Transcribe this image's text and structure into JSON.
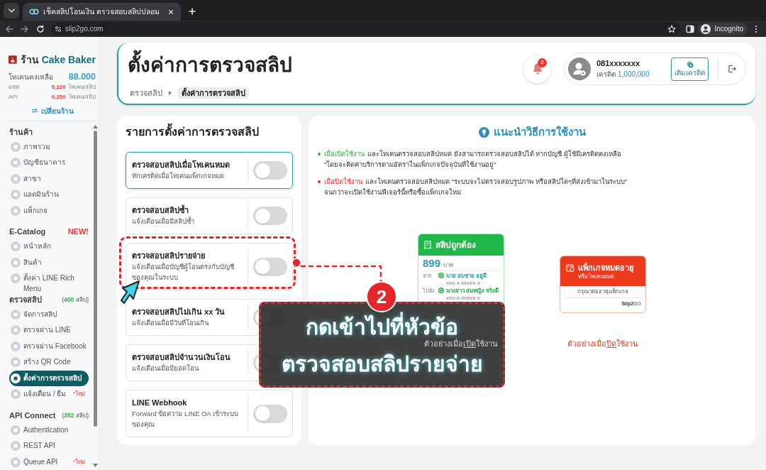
{
  "browser": {
    "tab_title": "เช็คสลิปโอนเงิน ตรวจสอบสลิปปลอม",
    "url": "slip2go.com",
    "profile": "Incognito"
  },
  "sidebar": {
    "shop": {
      "prefix": "ร้าน",
      "name": "Cake Baker"
    },
    "balance": {
      "label": "โทเคนคงเหลือ",
      "value": "88.000"
    },
    "rates": [
      {
        "label": "แชท",
        "value": "0.220",
        "unit": "โทเคน/สลิป"
      },
      {
        "label": "API",
        "value": "0.250",
        "unit": "โทเคน/สลิป"
      }
    ],
    "switch_shop": "เปลี่ยนร้าน",
    "sections": [
      {
        "title": "ร้านค้า",
        "items": [
          {
            "label": "ภาพรวม",
            "selected": false
          },
          {
            "label": "บัญชีธนาคาร",
            "selected": false
          },
          {
            "label": "สาขา",
            "selected": false
          },
          {
            "label": "แอดมินร้าน",
            "selected": false
          },
          {
            "label": "แพ็กเกจ",
            "selected": false
          }
        ]
      },
      {
        "title": "E-Catalog",
        "tag": "NEW!",
        "items": [
          {
            "label": "หน้าหลัก",
            "selected": false
          },
          {
            "label": "สินค้า",
            "selected": false
          },
          {
            "label": "ตั้งค่า LINE Rich\nMenu",
            "selected": false
          }
        ]
      },
      {
        "title": "ตรวจสลิป",
        "count": {
          "open": "(",
          "number": "400",
          "close": "สลิป)"
        },
        "items": [
          {
            "label": "จัดการสลิป",
            "selected": false
          },
          {
            "label": "ตรวจผ่าน LINE",
            "selected": false
          },
          {
            "label": "ตรวจผ่าน Facebook",
            "selected": false
          },
          {
            "label": "สร้าง QR Code",
            "selected": false
          },
          {
            "label": "ตั้งค่าการตรวจสลิป",
            "selected": true
          },
          {
            "label": "แจ้งเตือน / ธีม",
            "selected": false,
            "tag": "*ใหม่"
          }
        ]
      },
      {
        "title": "API Connect",
        "count": {
          "open": "(",
          "number": "352",
          "close": "สลิป)"
        },
        "items": [
          {
            "label": "Authentication",
            "selected": false
          },
          {
            "label": "REST API",
            "selected": false
          },
          {
            "label": "Queue API",
            "selected": false,
            "tag": "*ใหม่"
          }
        ]
      }
    ]
  },
  "header": {
    "title": "ตั้งค่าการตรวจสลิป",
    "breadcrumb": [
      {
        "label": "ตรวจสลิป",
        "current": false
      },
      {
        "label": "ตั้งค่าการตรวจสลิป",
        "current": true
      }
    ],
    "notification_count": "2",
    "user": {
      "phone": "081xxxxxxx",
      "credit_label": "เครดิต",
      "credit": "1,000,000"
    },
    "top_up": "เติมเครดิต"
  },
  "settings_panel": {
    "title": "รายการตั้งค่าการตรวจสลิป",
    "items": [
      {
        "title": "ตรวจสอบสลิปเมื่อโทเคนหมด",
        "description": "ทักเครดิตเมื่อโทเคนแพ็กเกจหมด",
        "on": false,
        "selected": true
      },
      {
        "title": "ตรวจสอบสลิปซ้ำ",
        "description": "แจ้งเตือนเมื่อมีสลิปซ้ำ",
        "on": false,
        "selected": false
      },
      {
        "title": "ตรวจสอบสลิปรายจ่าย",
        "description": "แจ้งเตือนเมื่อบัญชีผู้โอนตรงกับบัญชี\nของคุณในระบบ",
        "on": false,
        "selected": false
      },
      {
        "title": "ตรวจสอบสลิปไม่เกิน xx วัน",
        "description": "แจ้งเตือนเมื่อมีวันที่โอนเกิน",
        "on": false,
        "selected": false
      },
      {
        "title": "ตรวจสอบสลิปจำนวนเงินโอน",
        "description": "แจ้งเตือนเมื่อมียอดโอน",
        "on": false,
        "selected": false
      },
      {
        "title": "LINE Webhook",
        "description": "Forward ข้อความ LINE OA เข้าระบบ\nของคุณ",
        "on": false,
        "selected": false
      }
    ]
  },
  "guide_panel": {
    "title": "แนะนำวิธีการใช้งาน",
    "notes": [
      {
        "lead": "เมื่อเปิดใช้งาน",
        "text": "และโทเคนตรวจสอบสลิปหมด ยังสามารถตรวจสอบสลิปได้ หากบัญชี ผู้ใช้มีเครดิตคงเหลือ\n\"โดยจะคิดค่าบริการตามอัตราในแพ็กเกจปัจจุบันที่ใช้งานอยู่\"",
        "color": "#2fae3e"
      },
      {
        "lead": "เมื่อปิดใช้งาน",
        "text": "และโทเคนตรวจสอบสลิปหมด \"ระบบจะไม่ตรวจสอบรูปภาพ หรือสลิปใดๆที่ส่งเข้ามาในระบบ\"\nจนกว่าจะเปิดใช้งานฟีเจอร์นี้หรือซื้อแพ็กเกจใหม่",
        "color": "#e5262b"
      }
    ],
    "examples": [
      {
        "kind": "valid",
        "color": "#1fb84b",
        "title": "สลิปถูกต้อง",
        "amount": "899",
        "currency": "บาท",
        "parties": [
          {
            "label": "จาก",
            "name": "นาย สมชาย อยู่ดี",
            "account": "xxx-x-xxxxx-x",
            "color": "#2a9db5"
          },
          {
            "label": "ไปยัง",
            "name": "นางสาว สมหญิง จริงดี",
            "account": "xxx-x-xxxxx-x",
            "color": "#1fa84b"
          }
        ],
        "caption": {
          "before": "ตัวอย่างเมื่อ",
          "underlined": "เปิด",
          "after": "ใช้งาน"
        }
      },
      {
        "kind": "expired",
        "color": "#ee3a1c",
        "title": "แพ็กเกจหมดอายุ",
        "subtitle": "หรือโทเคนหมด",
        "notice": "กรุณาต่ออายุแพ็กเกจ",
        "logo": {
          "main": "Slip2",
          "accent": "GO"
        },
        "caption": {
          "before": "ตัวอย่างเมื่อ",
          "underlined": "ปิด",
          "after": "ใช้งาน"
        }
      }
    ]
  },
  "annotation": {
    "step": "2",
    "text": "กดเข้าไปที่หัวข้อ\nตรวจสอบสลิปรายจ่าย"
  }
}
